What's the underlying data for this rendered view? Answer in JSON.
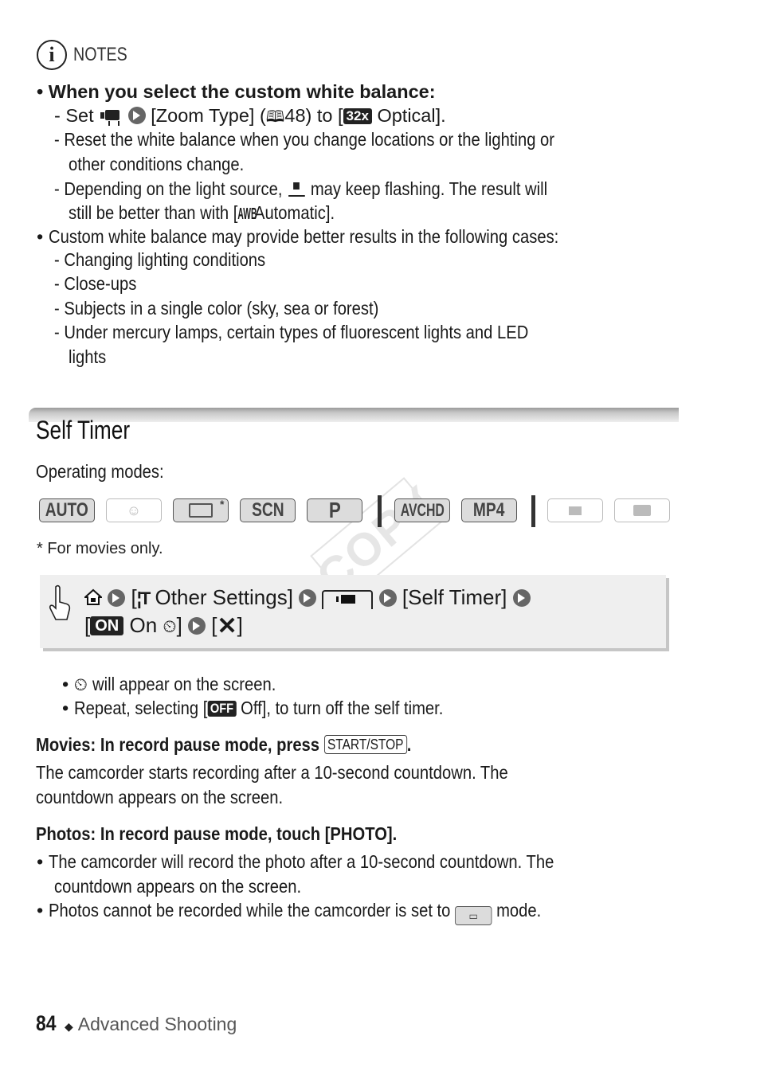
{
  "notes": {
    "label": "NOTES",
    "icon": "info-icon",
    "items": [
      {
        "heading": "When you select the custom white balance:",
        "subitems": [
          {
            "prefix": "- Set",
            "mid1": "[Zoom Type] (",
            "page_ref": "48",
            "mid2": ") to [",
            "badge": "32x",
            "suffix": "Optical]."
          },
          {
            "line1": "- Reset the white balance when you change locations or the lighting or",
            "line2": "other conditions change."
          },
          {
            "line1a": "- Depending on the light source,",
            "line1b": "may keep flashing. The result will",
            "line2a": "still be better than with [",
            "awb": "AWB",
            "line2b": "Automatic]."
          }
        ]
      },
      {
        "heading": "Custom white balance may provide better results in the following cases:",
        "subitems": [
          "- Changing lighting conditions",
          "- Close-ups",
          "- Subjects in a single color (sky, sea or forest)",
          "- Under mercury lamps, certain types of fluorescent lights and LED",
          "lights"
        ]
      }
    ]
  },
  "section": {
    "title": "Self Timer",
    "operating_modes_label": "Operating modes:",
    "modes": [
      {
        "label": "AUTO",
        "enabled": true
      },
      {
        "label": "",
        "icon": "baby-face-icon",
        "enabled": false
      },
      {
        "label": "",
        "icon": "cinema-mode-icon",
        "enabled": true,
        "asterisk": "*"
      },
      {
        "label": "SCN",
        "enabled": true
      },
      {
        "label": "P",
        "enabled": true
      },
      {
        "label": "AVCHD",
        "enabled": true
      },
      {
        "label": "MP4",
        "enabled": true
      },
      {
        "label": "",
        "icon": "movie-playback-icon",
        "enabled": false
      },
      {
        "label": "",
        "icon": "photo-playback-icon",
        "enabled": false
      }
    ],
    "footnote": "*  For movies only.",
    "watermark": "COPY"
  },
  "procedure": {
    "bracket_open": "[",
    "other_settings": "Other Settings]",
    "self_timer": "[Self Timer]",
    "on_badge": "ON",
    "on_label": "On",
    "close_bracket": "]",
    "x_open": "[",
    "x_close": "]"
  },
  "bullets_after": [
    {
      "text": "will appear on the screen."
    },
    {
      "prefix": "Repeat, selecting [",
      "badge": "OFF",
      "suffix": "Off], to turn off the self timer."
    }
  ],
  "movies": {
    "heading": "Movies: In record pause mode, press",
    "button": "START/STOP",
    "heading_end": ".",
    "body_line1": "The camcorder starts recording after a 10-second countdown. The",
    "body_line2": "countdown appears on the screen."
  },
  "photos": {
    "heading": "Photos: In record pause mode, touch [PHOTO].",
    "bullet1_line1": "The camcorder will record the photo after a 10-second countdown. The",
    "bullet1_line2": "countdown appears on the screen.",
    "bullet2_prefix": "Photos cannot be recorded while the camcorder is set to",
    "bullet2_suffix": "mode."
  },
  "footer": {
    "page_number": "84",
    "separator": "◆",
    "section": "Advanced Shooting"
  }
}
